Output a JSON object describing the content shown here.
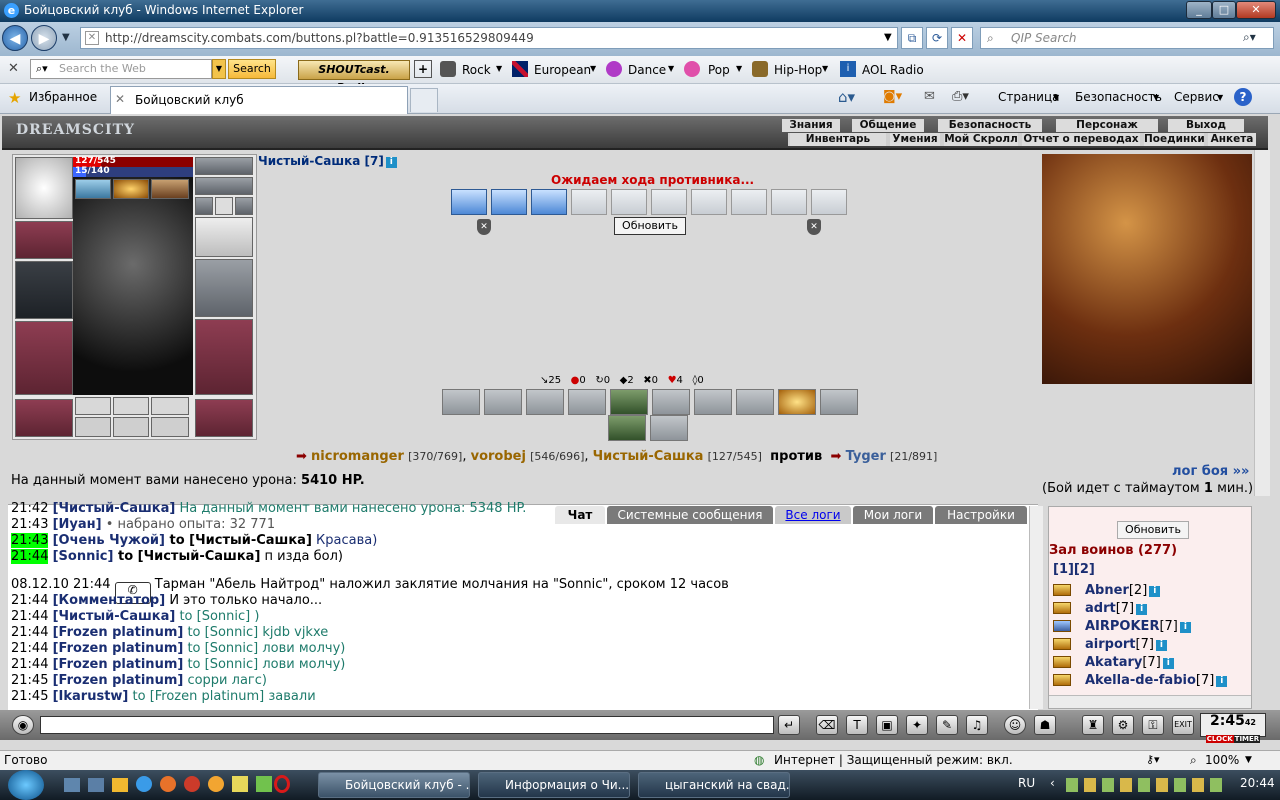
{
  "window": {
    "title": "Бойцовский клуб - Windows Internet Explorer"
  },
  "address": {
    "url": "http://dreamscity.combats.com/buttons.pl?battle=0.913516529809449",
    "qip_placeholder": "QIP Search"
  },
  "toolbar": {
    "search_placeholder": "Search the Web",
    "search_button": "Search",
    "shoutcast": "SHOUTcast. Radio",
    "items": [
      "Rock",
      "European",
      "Dance",
      "Pop",
      "Hip-Hop",
      "AOL Radio"
    ]
  },
  "favbar": {
    "favorites": "Избранное",
    "tab_title": "Бойцовский клуб",
    "page_menu": "Страница",
    "safety_menu": "Безопасность",
    "service_menu": "Сервис"
  },
  "site": {
    "logo": "DREAMSCITY",
    "menu1": [
      "Знания",
      "Общение",
      "Безопасность",
      "Персонаж",
      "Выход"
    ],
    "menu2": [
      "Инвентарь",
      "Умения",
      "Мой Скролл",
      "Отчет о переводах",
      "Поединки",
      "Анкета"
    ]
  },
  "char": {
    "hp": "127/545",
    "mana": "15/140",
    "name": "Чистый-Сашка [7]"
  },
  "battle": {
    "waiting": "Ожидаем хода противника...",
    "refresh": "Обновить",
    "stats": [
      "25",
      "0",
      "0",
      "2",
      "0",
      "4",
      "0"
    ],
    "team1": [
      {
        "name": "nicromanger",
        "hp": "[370/769]"
      },
      {
        "name": "vorobej",
        "hp": "[546/696]"
      },
      {
        "name": "Чистый-Сашка",
        "hp": "[127/545]"
      }
    ],
    "vs": "против",
    "team2": [
      {
        "name": "Tyger",
        "hp": "[21/891]"
      }
    ],
    "damage_label": "На данный момент вами нанесено урона:",
    "damage_value": "5410 HP.",
    "log_link": "лог боя »»",
    "timeout_pre": "(Бой идет с таймаутом",
    "timeout_num": "1",
    "timeout_post": "мин.)"
  },
  "chat": {
    "tabs": [
      "Чат",
      "Системные сообщения",
      "Все логи",
      "Мои логи",
      "Настройки"
    ],
    "lines": [
      {
        "time": "21:42",
        "nick": "[Чистый-Сашка]",
        "text": " На данный момент вами нанесено урона: 5348 HP."
      },
      {
        "time": "21:43",
        "nick": "[Иуан]",
        "text": " • набрано опыта: 32 771"
      },
      {
        "time": "21:43",
        "nick": "[Очень Чужой]",
        "to": " to [Чистый-Сашка]",
        "text": " Красава)"
      },
      {
        "time": "21:44",
        "nick": "[Sonnic]",
        "to": " to [Чистый-Сашка]",
        "text": " п изда бол)"
      },
      {
        "time": "08.12.10 21:44",
        "text": " Тарман \"Абель Найтрод\" наложил заклятие молчания на \"Sonnic\", сроком 12 часов"
      },
      {
        "time": "21:44",
        "nick": "[Комментатор]",
        "text": " И это только начало..."
      },
      {
        "time": "21:44",
        "nick": "[Чистый-Сашка]",
        "text": " to [Sonnic] )"
      },
      {
        "time": "21:44",
        "nick": "[Frozen platinum]",
        "text": " to [Sonnic] kjdb vjkxe"
      },
      {
        "time": "21:44",
        "nick": "[Frozen platinum]",
        "text": " to [Sonnic] лови молчу)"
      },
      {
        "time": "21:44",
        "nick": "[Frozen platinum]",
        "text": " to [Sonnic] лови молчу)"
      },
      {
        "time": "21:45",
        "nick": "[Frozen platinum]",
        "text": " сорри лагс)"
      },
      {
        "time": "21:45",
        "nick": "[Ikarustw]",
        "text": " to [Frozen platinum] завали"
      }
    ]
  },
  "warriors": {
    "refresh": "Обновить",
    "title": "Зал воинов (277)",
    "pages": "[1][2]",
    "list": [
      {
        "name": "Abner",
        "lv": "[2]"
      },
      {
        "name": "adrt",
        "lv": "[7]"
      },
      {
        "name": "AIRPOKER",
        "lv": "[7]"
      },
      {
        "name": "airport",
        "lv": "[7]"
      },
      {
        "name": "Akatary",
        "lv": "[7]"
      },
      {
        "name": "Akella-de-fabio",
        "lv": "[7]"
      }
    ]
  },
  "clock": {
    "time": "2:45",
    "sec": "42",
    "label_a": "CLOCK",
    "label_b": "TIMER"
  },
  "statusbar": {
    "left": "Готово",
    "zone": "Интернет | Защищенный режим: вкл.",
    "zoom": "100%"
  },
  "taskbar": {
    "tasks": [
      "Бойцовский клуб - ...",
      "Информация о Чи...",
      "цыганский на свад..."
    ],
    "lang": "RU",
    "time": "20:44"
  }
}
